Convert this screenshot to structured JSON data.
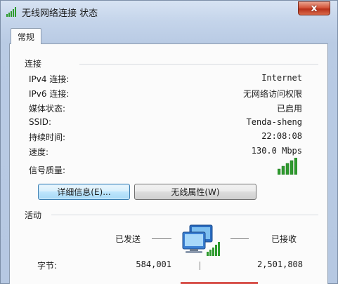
{
  "window": {
    "title": "无线网络连接 状态",
    "close_symbol": "x"
  },
  "tabs": [
    {
      "label": "常规"
    }
  ],
  "connection": {
    "section_title": "连接",
    "rows": [
      {
        "label": "IPv4 连接:",
        "value": "Internet"
      },
      {
        "label": "IPv6 连接:",
        "value": "无网络访问权限"
      },
      {
        "label": "媒体状态:",
        "value": "已启用"
      },
      {
        "label": "SSID:",
        "value": "Tenda-sheng"
      },
      {
        "label": "持续时间:",
        "value": "22:08:08"
      },
      {
        "label": "速度:",
        "value": "130.0 Mbps"
      }
    ],
    "signal_label": "信号质量:",
    "signal_bars_lit": 5,
    "signal_bars_total": 5,
    "details_button": "详细信息(E)...",
    "wireless_props_button": "无线属性(W)"
  },
  "activity": {
    "section_title": "活动",
    "sent_label": "已发送",
    "received_label": "已接收",
    "bytes_label": "字节:",
    "bytes_sent": "584,001",
    "bytes_received": "2,501,808"
  },
  "colors": {
    "signal_green": "#2e9b2e",
    "close_red": "#c7432a",
    "accent_red": "#d7514a"
  },
  "icons": {
    "title": "wireless-signal-icon",
    "signal": "wireless-signal-icon",
    "network": "network-computers-icon"
  }
}
